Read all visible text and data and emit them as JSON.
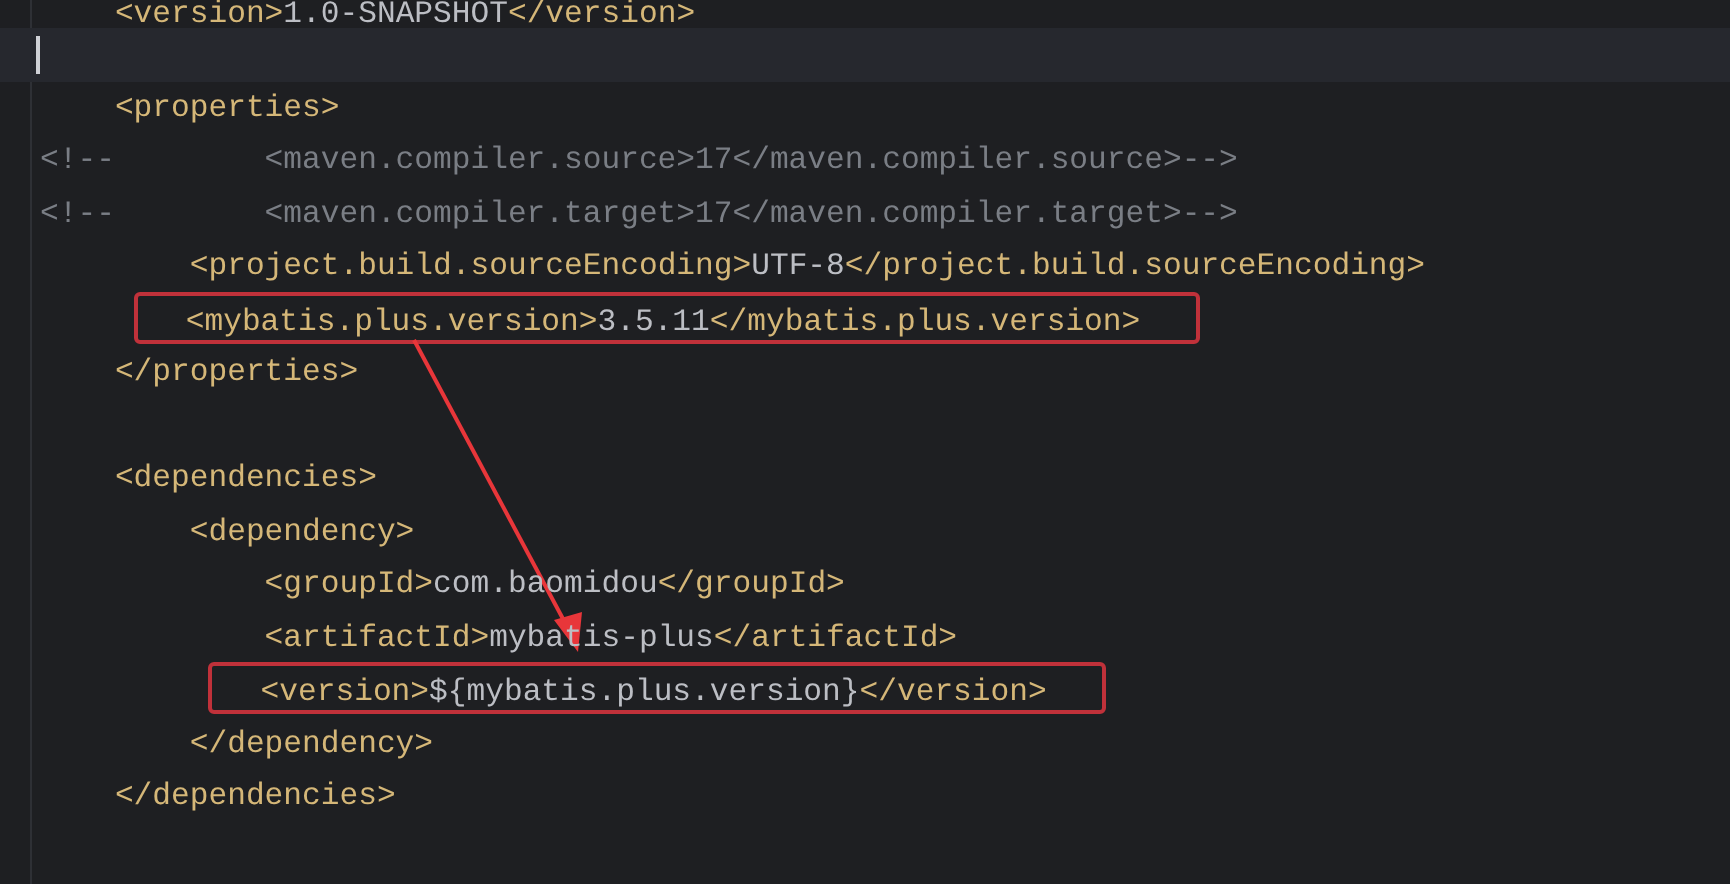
{
  "editor": {
    "lines": [
      {
        "current": false,
        "boxed": false,
        "tokens": [
          {
            "kind": "tag",
            "text": "    <version>"
          },
          {
            "kind": "text",
            "text": "1.0-SNAPSHOT"
          },
          {
            "kind": "tag",
            "text": "</version>"
          }
        ]
      },
      {
        "current": true,
        "boxed": false
      },
      {
        "current": false,
        "boxed": false,
        "tokens": [
          {
            "kind": "tag",
            "text": "    <properties>"
          }
        ]
      },
      {
        "current": false,
        "boxed": false,
        "tokens": [
          {
            "kind": "comment",
            "text": "<!--        <maven.compiler.source>17</maven.compiler.source>-->"
          }
        ]
      },
      {
        "current": false,
        "boxed": false,
        "tokens": [
          {
            "kind": "comment",
            "text": "<!--        <maven.compiler.target>17</maven.compiler.target>-->"
          }
        ]
      },
      {
        "current": false,
        "boxed": false,
        "tokens": [
          {
            "kind": "tag",
            "text": "        <project.build.sourceEncoding>"
          },
          {
            "kind": "text",
            "text": "UTF-8"
          },
          {
            "kind": "tag",
            "text": "</project.build.sourceEncoding>"
          }
        ]
      },
      {
        "current": false,
        "boxed": true,
        "arrow_from": true,
        "tokens": [
          {
            "kind": "tag",
            "text": "        <mybatis.plus.version>"
          },
          {
            "kind": "text",
            "text": "3.5.11"
          },
          {
            "kind": "tag",
            "text": "</mybatis.plus.version>"
          }
        ]
      },
      {
        "current": false,
        "boxed": false,
        "tokens": [
          {
            "kind": "tag",
            "text": "    </properties>"
          }
        ]
      },
      {
        "current": false,
        "boxed": false
      },
      {
        "current": false,
        "boxed": false,
        "tokens": [
          {
            "kind": "tag",
            "text": "    <dependencies>"
          }
        ]
      },
      {
        "current": false,
        "boxed": false,
        "tokens": [
          {
            "kind": "tag",
            "text": "        <dependency>"
          }
        ]
      },
      {
        "current": false,
        "boxed": false,
        "tokens": [
          {
            "kind": "tag",
            "text": "            <groupId>"
          },
          {
            "kind": "text",
            "text": "com.baomidou"
          },
          {
            "kind": "tag",
            "text": "</groupId>"
          }
        ]
      },
      {
        "current": false,
        "boxed": false,
        "tokens": [
          {
            "kind": "tag",
            "text": "            <artifactId>"
          },
          {
            "kind": "text",
            "text": "mybatis-plus"
          },
          {
            "kind": "tag",
            "text": "</artifactId>"
          }
        ]
      },
      {
        "current": false,
        "boxed": true,
        "tokens": [
          {
            "kind": "tag",
            "text": "            <version>"
          },
          {
            "kind": "text",
            "text": "${mybatis.plus.version}"
          },
          {
            "kind": "tag",
            "text": "</version>"
          }
        ]
      },
      {
        "current": false,
        "boxed": false,
        "tokens": [
          {
            "kind": "tag",
            "text": "        </dependency>"
          }
        ]
      },
      {
        "current": false,
        "boxed": false,
        "tokens": [
          {
            "kind": "tag",
            "text": "    </dependencies>"
          }
        ]
      }
    ]
  }
}
